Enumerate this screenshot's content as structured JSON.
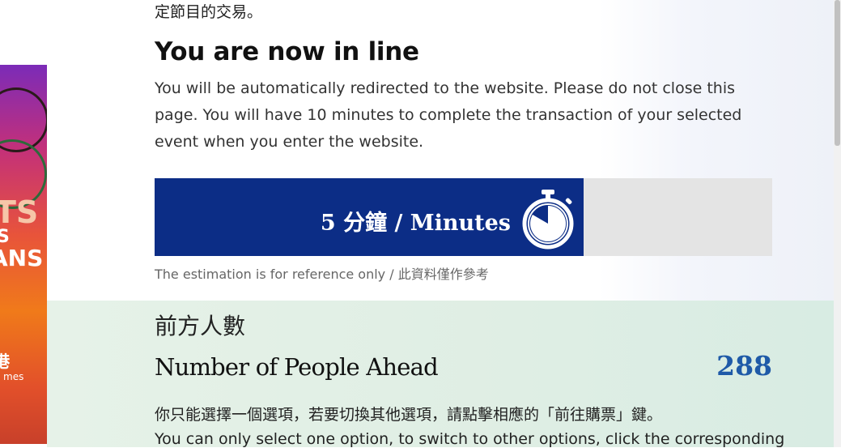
{
  "page": {
    "top_text": "定節目的交易。",
    "heading": "You are now in line",
    "description": "You will be automatically redirected to the website. Please do not close this page. You will have 10 minutes to complete the transaction of your selected event when you enter the website."
  },
  "progress": {
    "label": "5 分鐘 / Minutes",
    "fraction": 0.694,
    "fill_color": "#0c2d86",
    "track_color": "#e4e4e4",
    "icon": "stopwatch-icon"
  },
  "estimate_note": "The estimation is for reference only / 此資料僅作參考",
  "queue": {
    "label_cn": "前方人數",
    "label_en": "Number of People Ahead",
    "count": "288"
  },
  "instructions": {
    "cn": "你只能選擇一個選項，若要切換其他選項，請點擊相應的「前往購票」鍵。",
    "en": "You can only select one option, to switch to other options, click the corresponding"
  },
  "banner": {
    "text_1": "TS",
    "text_2": "S",
    "text_3": "ANS",
    "text_4": "港",
    "text_5": "mes"
  }
}
